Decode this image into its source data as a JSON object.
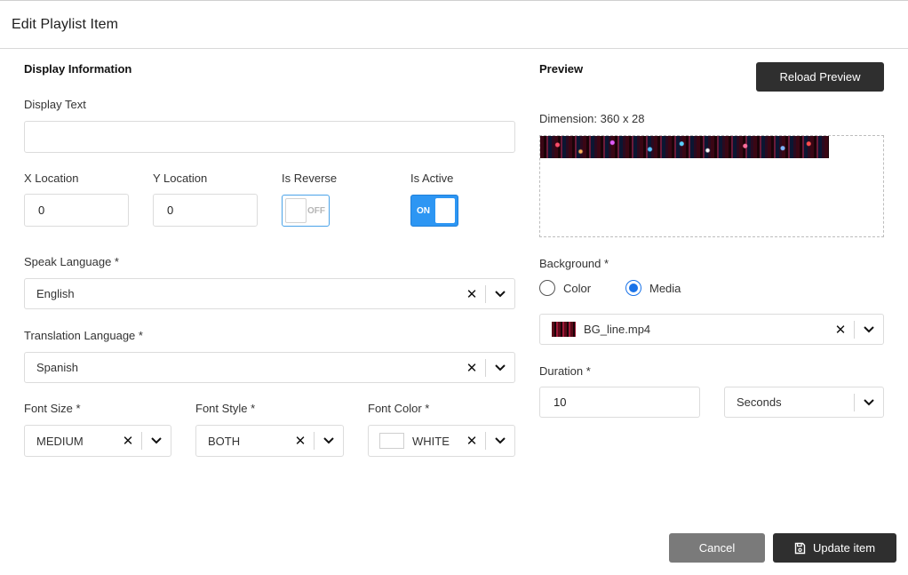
{
  "modal": {
    "title": "Edit Playlist Item"
  },
  "display_info": {
    "section_title": "Display Information",
    "display_text": {
      "label": "Display Text",
      "value": ""
    },
    "x_location": {
      "label": "X Location",
      "value": "0"
    },
    "y_location": {
      "label": "Y Location",
      "value": "0"
    },
    "is_reverse": {
      "label": "Is Reverse",
      "state": "OFF"
    },
    "is_active": {
      "label": "Is Active",
      "state": "ON"
    },
    "speak_language": {
      "label": "Speak Language *",
      "value": "English"
    },
    "translation_language": {
      "label": "Translation Language *",
      "value": "Spanish"
    },
    "font_size": {
      "label": "Font Size *",
      "value": "MEDIUM"
    },
    "font_style": {
      "label": "Font Style *",
      "value": "BOTH"
    },
    "font_color": {
      "label": "Font Color *",
      "value": "WHITE",
      "swatch": "#ffffff"
    }
  },
  "preview": {
    "section_title": "Preview",
    "reload_label": "Reload Preview",
    "dimension": "Dimension: 360 x 28",
    "background": {
      "label": "Background *",
      "options": [
        "Color",
        "Media"
      ],
      "selected": "Media",
      "media_file": "BG_line.mp4"
    },
    "duration": {
      "label": "Duration *",
      "value": "10",
      "unit": "Seconds"
    }
  },
  "footer": {
    "cancel_label": "Cancel",
    "update_label": "Update item"
  },
  "colors": {
    "accent": "#2d96f3",
    "dark_button": "#2f2f2f",
    "cancel_button": "#7a7a7a"
  }
}
